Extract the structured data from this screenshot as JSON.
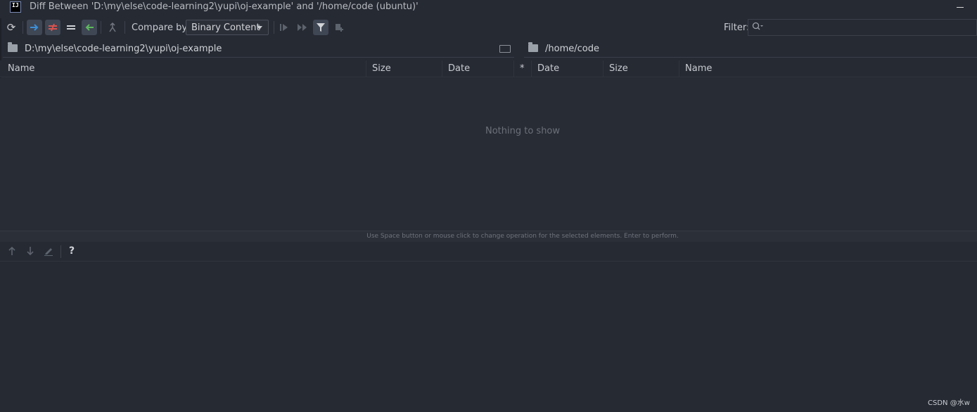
{
  "window": {
    "title": "Diff Between 'D:\\my\\else\\code-learning2\\yupi\\oj-example' and '/home/code (ubuntu)'",
    "logo_text": "IJ"
  },
  "toolbar": {
    "compare_label": "Compare by:",
    "compare_value": "Binary Content",
    "filter_label": "Filter:",
    "filter_value": "",
    "icons": {
      "refresh": "refresh-icon",
      "left_to_right": "arrow-right-icon",
      "not_equal": "not-equal-icon",
      "equal": "equal-icon",
      "right_to_left": "arrow-left-icon",
      "merge": "merge-icon",
      "step": "step-icon",
      "step_all": "fast-forward-icon",
      "filter": "filter-icon",
      "sync": "sync-icon"
    },
    "colors": {
      "left_to_right": "#3d8fd6",
      "not_equal": "#d9534f",
      "right_to_left": "#5fb85f"
    }
  },
  "paths": {
    "left": "D:\\my\\else\\code-learning2\\yupi\\oj-example",
    "right": "/home/code"
  },
  "table": {
    "columns": [
      "Name",
      "Size",
      "Date",
      "*",
      "Date",
      "Size",
      "Name"
    ],
    "empty_text": "Nothing to show"
  },
  "hint": "Use Space button or mouse click to change operation for the selected elements. Enter to perform.",
  "bottom_toolbar": {
    "help_label": "?"
  },
  "watermark": "CSDN @水w"
}
